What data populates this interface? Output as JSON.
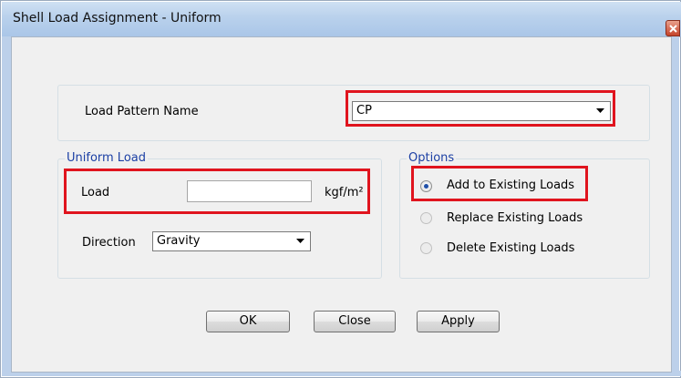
{
  "window": {
    "title": "Shell Load Assignment - Uniform"
  },
  "load_pattern": {
    "label": "Load Pattern Name",
    "selected": "CP"
  },
  "uniform_load": {
    "group_title": "Uniform Load",
    "load_label": "Load",
    "load_value": "",
    "unit": "kgf/m²",
    "direction_label": "Direction",
    "direction_selected": "Gravity"
  },
  "options": {
    "group_title": "Options",
    "items": [
      {
        "label": "Add to Existing Loads",
        "selected": true
      },
      {
        "label": "Replace Existing Loads",
        "selected": false
      },
      {
        "label": "Delete Existing Loads",
        "selected": false
      }
    ]
  },
  "buttons": {
    "ok": "OK",
    "close": "Close",
    "apply": "Apply"
  },
  "colors": {
    "highlight": "#e0141e",
    "group_title": "#1b3fa4",
    "dialog_bg": "#f0f0f0",
    "titlebar": "#b9d1ec"
  }
}
